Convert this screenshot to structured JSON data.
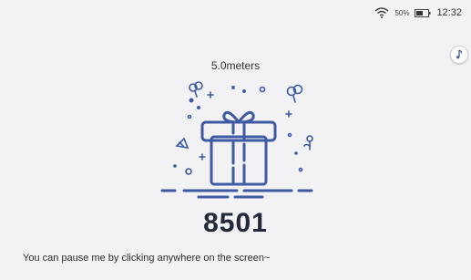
{
  "status_bar": {
    "wifi_icon": "wifi-icon",
    "battery_percent": "50%",
    "battery_icon": "battery-icon",
    "time": "12:32"
  },
  "side_button": {
    "icon": "music-note-icon"
  },
  "main": {
    "distance": "5.0meters",
    "counter": "8501",
    "illustration_icon": "gift-icon"
  },
  "hint": {
    "text": "You can pause me by clicking anywhere on the screen~"
  },
  "colors": {
    "accent": "#3d5aa3",
    "background": "#f2f2f4",
    "text": "#23283a"
  }
}
